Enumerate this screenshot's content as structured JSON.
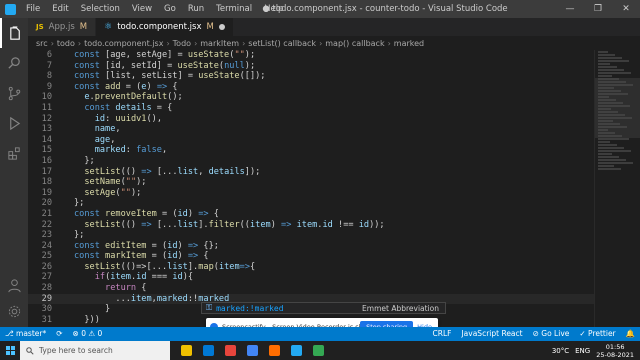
{
  "titlebar": {
    "menu": [
      "File",
      "Edit",
      "Selection",
      "View",
      "Go",
      "Run",
      "Terminal",
      "Help"
    ],
    "title": "● todo.component.jsx - counter-todo - Visual Studio Code",
    "minimize": "—",
    "maximize": "❐",
    "close": "✕"
  },
  "tabs": [
    {
      "icon": "JS",
      "label": "App.js",
      "status": "M"
    },
    {
      "icon": "⚛",
      "label": "todo.component.jsx",
      "status": "M"
    }
  ],
  "breadcrumb": [
    "src",
    "todo",
    "todo.component.jsx",
    "Todo",
    "markItem",
    "setList() callback",
    "map() callback",
    "marked"
  ],
  "editor": {
    "lines": [
      {
        "n": "6",
        "tokens": [
          [
            "kw",
            "const "
          ],
          [
            "punc",
            "[age, setAge] = "
          ],
          [
            "fn",
            "useState"
          ],
          [
            "punc",
            "("
          ],
          [
            "str",
            "\"\""
          ],
          [
            "punc",
            ");"
          ]
        ]
      },
      {
        "n": "7",
        "tokens": [
          [
            "kw",
            "const "
          ],
          [
            "punc",
            "[id, setId] = "
          ],
          [
            "fn",
            "useState"
          ],
          [
            "punc",
            "("
          ],
          [
            "kw",
            "null"
          ],
          [
            "punc",
            ");"
          ]
        ]
      },
      {
        "n": "8",
        "tokens": [
          [
            "kw",
            "const "
          ],
          [
            "punc",
            "[list, setList] = "
          ],
          [
            "fn",
            "useState"
          ],
          [
            "punc",
            "([]);"
          ]
        ]
      },
      {
        "n": "9",
        "tokens": [
          [
            "kw",
            "const "
          ],
          [
            "fn",
            "add"
          ],
          [
            "punc",
            " = ("
          ],
          [
            "var",
            "e"
          ],
          [
            "punc",
            ") "
          ],
          [
            "kw",
            "=>"
          ],
          [
            "punc",
            " {"
          ]
        ]
      },
      {
        "n": "10",
        "tokens": [
          [
            "punc",
            "  "
          ],
          [
            "var",
            "e"
          ],
          [
            "punc",
            "."
          ],
          [
            "fn",
            "preventDefault"
          ],
          [
            "punc",
            "();"
          ]
        ]
      },
      {
        "n": "11",
        "tokens": [
          [
            "punc",
            "  "
          ],
          [
            "kw",
            "const "
          ],
          [
            "var",
            "details"
          ],
          [
            "punc",
            " = {"
          ]
        ]
      },
      {
        "n": "12",
        "tokens": [
          [
            "punc",
            "    "
          ],
          [
            "var",
            "id"
          ],
          [
            "punc",
            ": "
          ],
          [
            "fn",
            "uuidv1"
          ],
          [
            "punc",
            "(),"
          ]
        ]
      },
      {
        "n": "13",
        "tokens": [
          [
            "punc",
            "    "
          ],
          [
            "var",
            "name"
          ],
          [
            "punc",
            ","
          ]
        ]
      },
      {
        "n": "14",
        "tokens": [
          [
            "punc",
            "    "
          ],
          [
            "var",
            "age"
          ],
          [
            "punc",
            ","
          ]
        ]
      },
      {
        "n": "15",
        "tokens": [
          [
            "punc",
            "    "
          ],
          [
            "var",
            "marked"
          ],
          [
            "punc",
            ": "
          ],
          [
            "kw",
            "false"
          ],
          [
            "punc",
            ","
          ]
        ]
      },
      {
        "n": "16",
        "tokens": [
          [
            "punc",
            "  };"
          ]
        ]
      },
      {
        "n": "17",
        "tokens": [
          [
            "punc",
            "  "
          ],
          [
            "fn",
            "setList"
          ],
          [
            "punc",
            "(() "
          ],
          [
            "kw",
            "=>"
          ],
          [
            "punc",
            " [..."
          ],
          [
            "var",
            "list"
          ],
          [
            "punc",
            ", "
          ],
          [
            "var",
            "details"
          ],
          [
            "punc",
            "]);"
          ]
        ]
      },
      {
        "n": "18",
        "tokens": [
          [
            "punc",
            "  "
          ],
          [
            "fn",
            "setName"
          ],
          [
            "punc",
            "("
          ],
          [
            "str",
            "\"\""
          ],
          [
            "punc",
            ");"
          ]
        ]
      },
      {
        "n": "19",
        "tokens": [
          [
            "punc",
            "  "
          ],
          [
            "fn",
            "setAge"
          ],
          [
            "punc",
            "("
          ],
          [
            "str",
            "\"\""
          ],
          [
            "punc",
            ");"
          ]
        ]
      },
      {
        "n": "20",
        "tokens": [
          [
            "punc",
            "};"
          ]
        ]
      },
      {
        "n": "21",
        "tokens": [
          [
            "kw",
            "const "
          ],
          [
            "fn",
            "removeItem"
          ],
          [
            "punc",
            " = ("
          ],
          [
            "var",
            "id"
          ],
          [
            "punc",
            ") "
          ],
          [
            "kw",
            "=>"
          ],
          [
            "punc",
            " {"
          ]
        ]
      },
      {
        "n": "22",
        "tokens": [
          [
            "punc",
            "  "
          ],
          [
            "fn",
            "setList"
          ],
          [
            "punc",
            "(() "
          ],
          [
            "kw",
            "=>"
          ],
          [
            "punc",
            " [..."
          ],
          [
            "var",
            "list"
          ],
          [
            "punc",
            "]."
          ],
          [
            "fn",
            "filter"
          ],
          [
            "punc",
            "(("
          ],
          [
            "var",
            "item"
          ],
          [
            "punc",
            ") "
          ],
          [
            "kw",
            "=>"
          ],
          [
            "punc",
            " "
          ],
          [
            "var",
            "item"
          ],
          [
            "punc",
            "."
          ],
          [
            "var",
            "id"
          ],
          [
            "punc",
            " !== "
          ],
          [
            "var",
            "id"
          ],
          [
            "punc",
            "));"
          ]
        ]
      },
      {
        "n": "23",
        "tokens": [
          [
            "punc",
            "};"
          ]
        ]
      },
      {
        "n": "24",
        "tokens": [
          [
            "kw",
            "const "
          ],
          [
            "fn",
            "editItem"
          ],
          [
            "punc",
            " = ("
          ],
          [
            "var",
            "id"
          ],
          [
            "punc",
            ") "
          ],
          [
            "kw",
            "=>"
          ],
          [
            "punc",
            " {};"
          ]
        ]
      },
      {
        "n": "25",
        "tokens": [
          [
            "kw",
            "const "
          ],
          [
            "fn",
            "markItem"
          ],
          [
            "punc",
            " = ("
          ],
          [
            "var",
            "id"
          ],
          [
            "punc",
            ") "
          ],
          [
            "kw",
            "=>"
          ],
          [
            "punc",
            " {"
          ]
        ]
      },
      {
        "n": "26",
        "tokens": [
          [
            "punc",
            "  "
          ],
          [
            "fn",
            "setList"
          ],
          [
            "punc",
            "(()=>[..."
          ],
          [
            "var",
            "list"
          ],
          [
            "punc",
            "]."
          ],
          [
            "fn",
            "map"
          ],
          [
            "punc",
            "("
          ],
          [
            "var",
            "item"
          ],
          [
            "kw",
            "=>"
          ],
          [
            "punc",
            "{"
          ]
        ]
      },
      {
        "n": "27",
        "tokens": [
          [
            "punc",
            "    "
          ],
          [
            "kw2",
            "if"
          ],
          [
            "punc",
            "("
          ],
          [
            "var",
            "item"
          ],
          [
            "punc",
            "."
          ],
          [
            "var",
            "id"
          ],
          [
            "punc",
            " === "
          ],
          [
            "var",
            "id"
          ],
          [
            "punc",
            "){"
          ]
        ]
      },
      {
        "n": "28",
        "tokens": [
          [
            "punc",
            "      "
          ],
          [
            "kw2",
            "return"
          ],
          [
            "punc",
            " {"
          ]
        ]
      },
      {
        "n": "29",
        "tokens": [
          [
            "punc",
            "        ..."
          ],
          [
            "var",
            "item"
          ],
          [
            "punc",
            ","
          ],
          [
            "var",
            "marked"
          ],
          [
            "punc",
            ":!"
          ],
          [
            "var",
            "marked"
          ]
        ]
      },
      {
        "n": "30",
        "tokens": [
          [
            "punc",
            "      }"
          ]
        ]
      },
      {
        "n": "31",
        "tokens": [
          [
            "punc",
            "  }))"
          ]
        ]
      }
    ],
    "current_line": "29"
  },
  "suggest": {
    "icon": "⚿",
    "text": "marked:!marked",
    "detail": "Emmet Abbreviation"
  },
  "banner": {
    "text": "Screencastify - Screen Video Recorder is sharing your screen.",
    "stop": "Stop sharing",
    "hide": "Hide"
  },
  "statusbar": {
    "branch": "⎇ master*",
    "sync": "⟳",
    "errors": "⊗ 0 ⚠ 0",
    "crlf": "CRLF",
    "language": "JavaScript React",
    "golive": "⊘ Go Live",
    "prettier": "✓ Prettier",
    "bell": "🔔"
  },
  "taskbar": {
    "search_placeholder": "Type here to search",
    "weather": "30°C",
    "lang": "ENG",
    "time": "01:56",
    "date": "25-08-2021",
    "app_colors": [
      "#f0c000",
      "#0078d4",
      "#e8453c",
      "#4285f4",
      "#ff6d00",
      "#23a9f2",
      "#34a853"
    ]
  }
}
